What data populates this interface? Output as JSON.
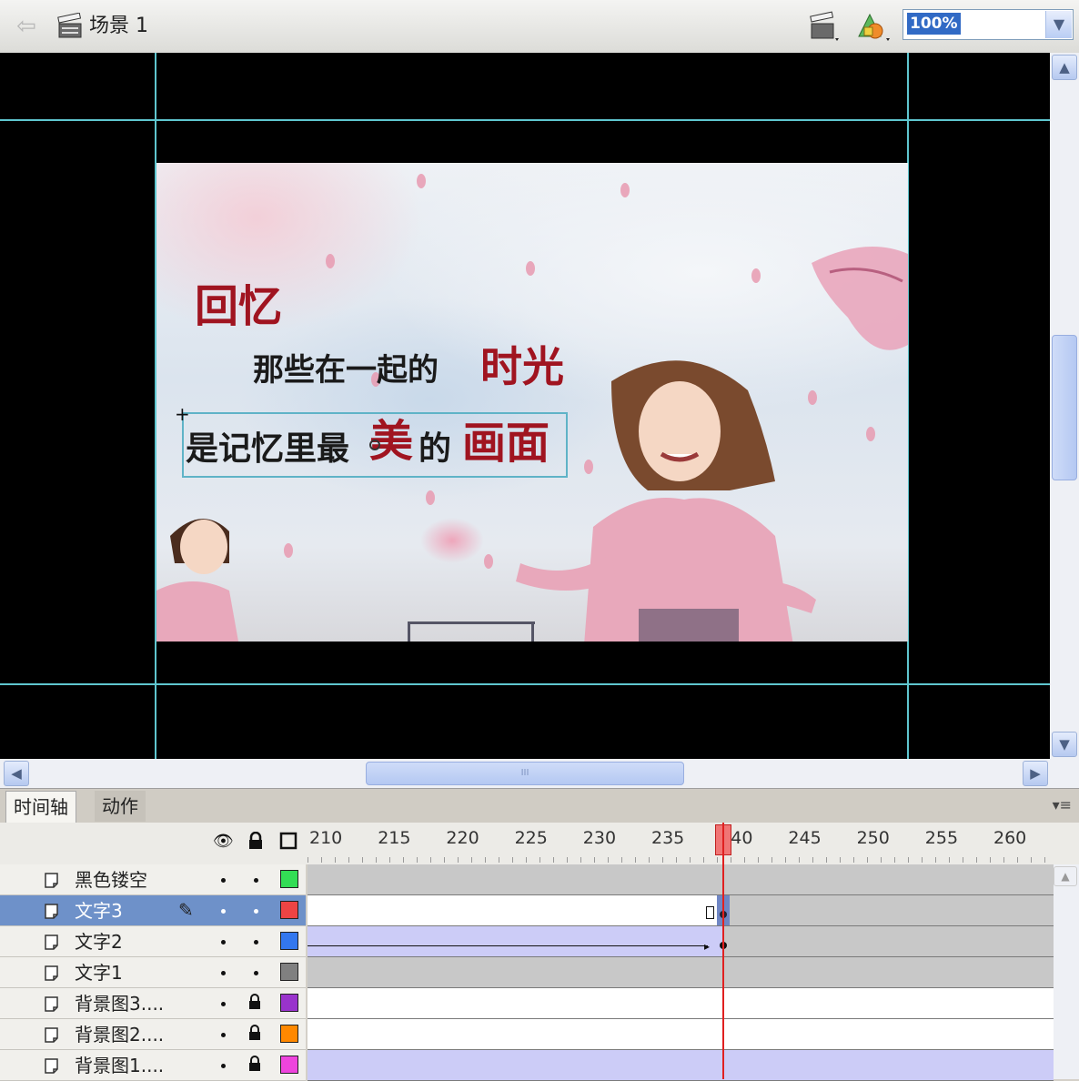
{
  "toolbar": {
    "back_icon": "arrow-left-icon",
    "scene_icon": "clapperboard-icon",
    "scene_label": "场景 1",
    "edit_scene_icon": "edit-scene-icon",
    "edit_symbol_icon": "edit-symbol-icon",
    "zoom_value": "100%"
  },
  "stage": {
    "background_color": "#000000",
    "guide_color": "#5fc6cf",
    "text_line1": "回忆",
    "text_line2_plain": "那些在一起的",
    "text_line2_emph": "时光",
    "text_line3_a": "是记忆里最",
    "text_line3_b": "美",
    "text_line3_c": "的",
    "text_line3_d": "画面",
    "accent_red": "#a01420"
  },
  "scrollbars": {
    "h_grip": "III",
    "v_grip": "≡"
  },
  "timeline": {
    "tabs": [
      {
        "label": "时间轴"
      },
      {
        "label": "动作"
      }
    ],
    "menu_icon": "panel-menu-icon",
    "header_icons": [
      "eye-icon",
      "lock-icon",
      "outline-icon"
    ],
    "frame_numbers": [
      "210",
      "215",
      "220",
      "225",
      "230",
      "235",
      "240",
      "245",
      "250",
      "255",
      "260"
    ],
    "current_frame": 240,
    "layers": [
      {
        "name": "黑色镂空",
        "color": "#33dd55",
        "locked": false,
        "selected": false
      },
      {
        "name": "文字3",
        "color": "#ee4444",
        "locked": false,
        "selected": true
      },
      {
        "name": "文字2",
        "color": "#3377ee",
        "locked": false,
        "selected": false
      },
      {
        "name": "文字1",
        "color": "#808080",
        "locked": false,
        "selected": false
      },
      {
        "name": "背景图3....",
        "color": "#9933cc",
        "locked": true,
        "selected": false
      },
      {
        "name": "背景图2....",
        "color": "#ff8800",
        "locked": true,
        "selected": false
      },
      {
        "name": "背景图1....",
        "color": "#ee44dd",
        "locked": true,
        "selected": false
      }
    ]
  }
}
